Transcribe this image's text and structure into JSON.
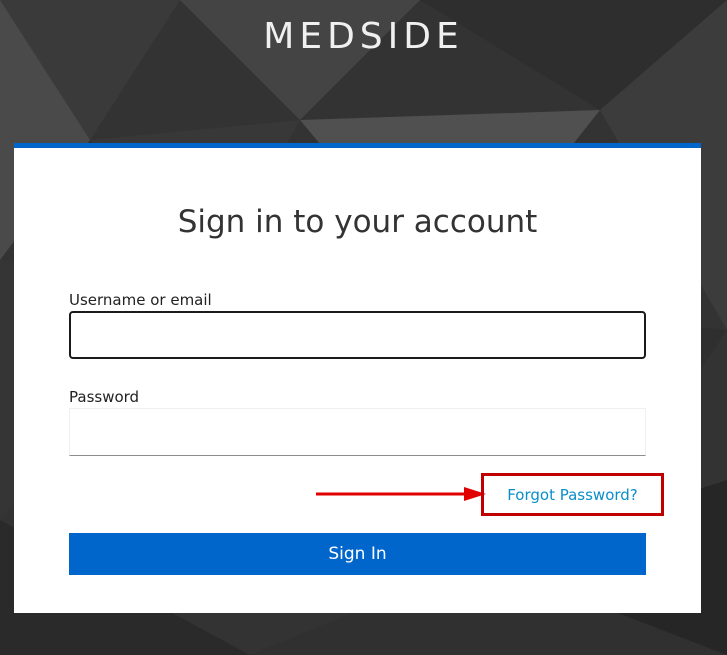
{
  "brand": {
    "name": "MEDSIDE"
  },
  "login": {
    "title": "Sign in to your account",
    "username_label": "Username or email",
    "username_value": "",
    "password_label": "Password",
    "password_value": "",
    "forgot_password": "Forgot Password?",
    "submit_label": "Sign In"
  },
  "colors": {
    "primary": "#0066cc",
    "link": "#0a8ec9",
    "highlight": "#c00000",
    "background": "#333333"
  }
}
